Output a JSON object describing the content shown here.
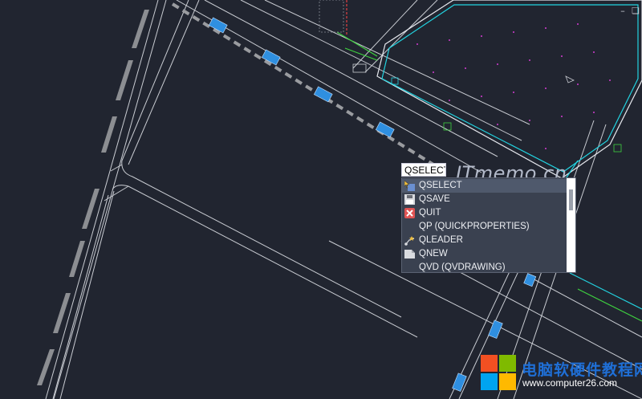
{
  "window_controls": {
    "minimize_icon": "minimize-icon",
    "restore_icon": "restore-icon"
  },
  "command_line": {
    "input_value": "QSELECT"
  },
  "autocomplete": {
    "items": [
      {
        "label": "QSELECT",
        "icon": "qselect-icon",
        "selected": true
      },
      {
        "label": "QSAVE",
        "icon": "save-icon",
        "selected": false
      },
      {
        "label": "QUIT",
        "icon": "quit-icon",
        "selected": false
      },
      {
        "label": "QP (QUICKPROPERTIES)",
        "icon": "",
        "selected": false
      },
      {
        "label": "QLEADER",
        "icon": "leader-icon",
        "selected": false
      },
      {
        "label": "QNEW",
        "icon": "new-file-icon",
        "selected": false
      },
      {
        "label": "QVD (QVDRAWING)",
        "icon": "",
        "selected": false
      }
    ]
  },
  "watermark": {
    "text": "ITmemo.cn"
  },
  "brand": {
    "name": "电脑软硬件教程网",
    "url": "www.computer26.com",
    "logo_colors": [
      "#f25022",
      "#7fba00",
      "#00a4ef",
      "#ffb900"
    ]
  },
  "colors": {
    "canvas_bg": "#212530",
    "road_line": "#c8c8c8",
    "car_blue": "#2f8fe0",
    "cyan_line": "#22d3e0",
    "magenta_dot": "#d23cd2",
    "green_line": "#3fd23f"
  }
}
